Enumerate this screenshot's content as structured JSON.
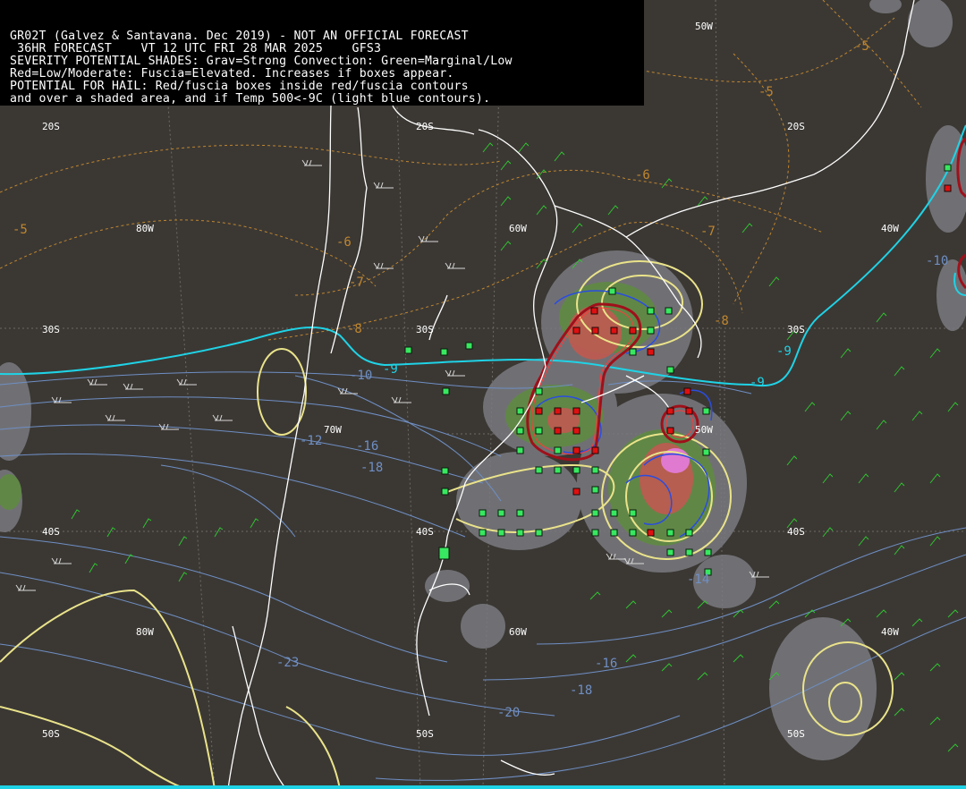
{
  "header": {
    "lines": [
      "GR02T (Galvez & Santavana. Dec 2019) - NOT AN OFFICIAL FORECAST",
      " 36HR FORECAST    VT 12 UTC FRI 28 MAR 2025    GFS3",
      "SEVERITY POTENTIAL SHADES: Grav=Strong Convection: Green=Marginal/Low",
      "Red=Low/Moderate: Fuscia=Elevated. Increases if boxes appear.",
      "POTENTIAL FOR HAIL: Red/fuscia boxes inside red/fuscia contours",
      "and over a shaded area, and if Temp 500<-9C (light blue contours)."
    ]
  },
  "grid_labels": {
    "lat_20s": "20S",
    "lat_30s": "30S",
    "lat_40s": "40S",
    "lat_50s": "50S",
    "lon_80w": "80W",
    "lon_60w": "60W",
    "lon_50w": "50W",
    "lon_40w": "40W",
    "lon_70w": "70W"
  },
  "temperature_labels": {
    "t_m5": "-5",
    "t_m6": "-6",
    "t_m7": "-7",
    "t_m8": "-8",
    "t_m9": "-9",
    "t_m10": "-10",
    "t_m12": "-12",
    "t_m14": "-14",
    "t_m16": "-16",
    "t_m18": "-18",
    "t_m20": "-20",
    "t_m23": "-23"
  },
  "colors": {
    "background": "#3b3834",
    "coastline": "#ffffff",
    "strong_convection_shade": "#7a7a80",
    "marginal_shade": "#5f8a42",
    "moderate_shade": "#c05a50",
    "elevated_shade": "#e07ad0",
    "temp_contour_orange": "#c0862e",
    "temp_contour_cyan": "#1fd3e6",
    "temp_contour_lightblue": "#6f8fc4",
    "severity_contour_yellow": "#eae38a",
    "hail_contour_red": "#a0101a",
    "box_green": "#38e860",
    "box_red": "#e01010",
    "wind_barb_green": "#2fc42f",
    "wind_barb_white": "#d8d8d8"
  }
}
